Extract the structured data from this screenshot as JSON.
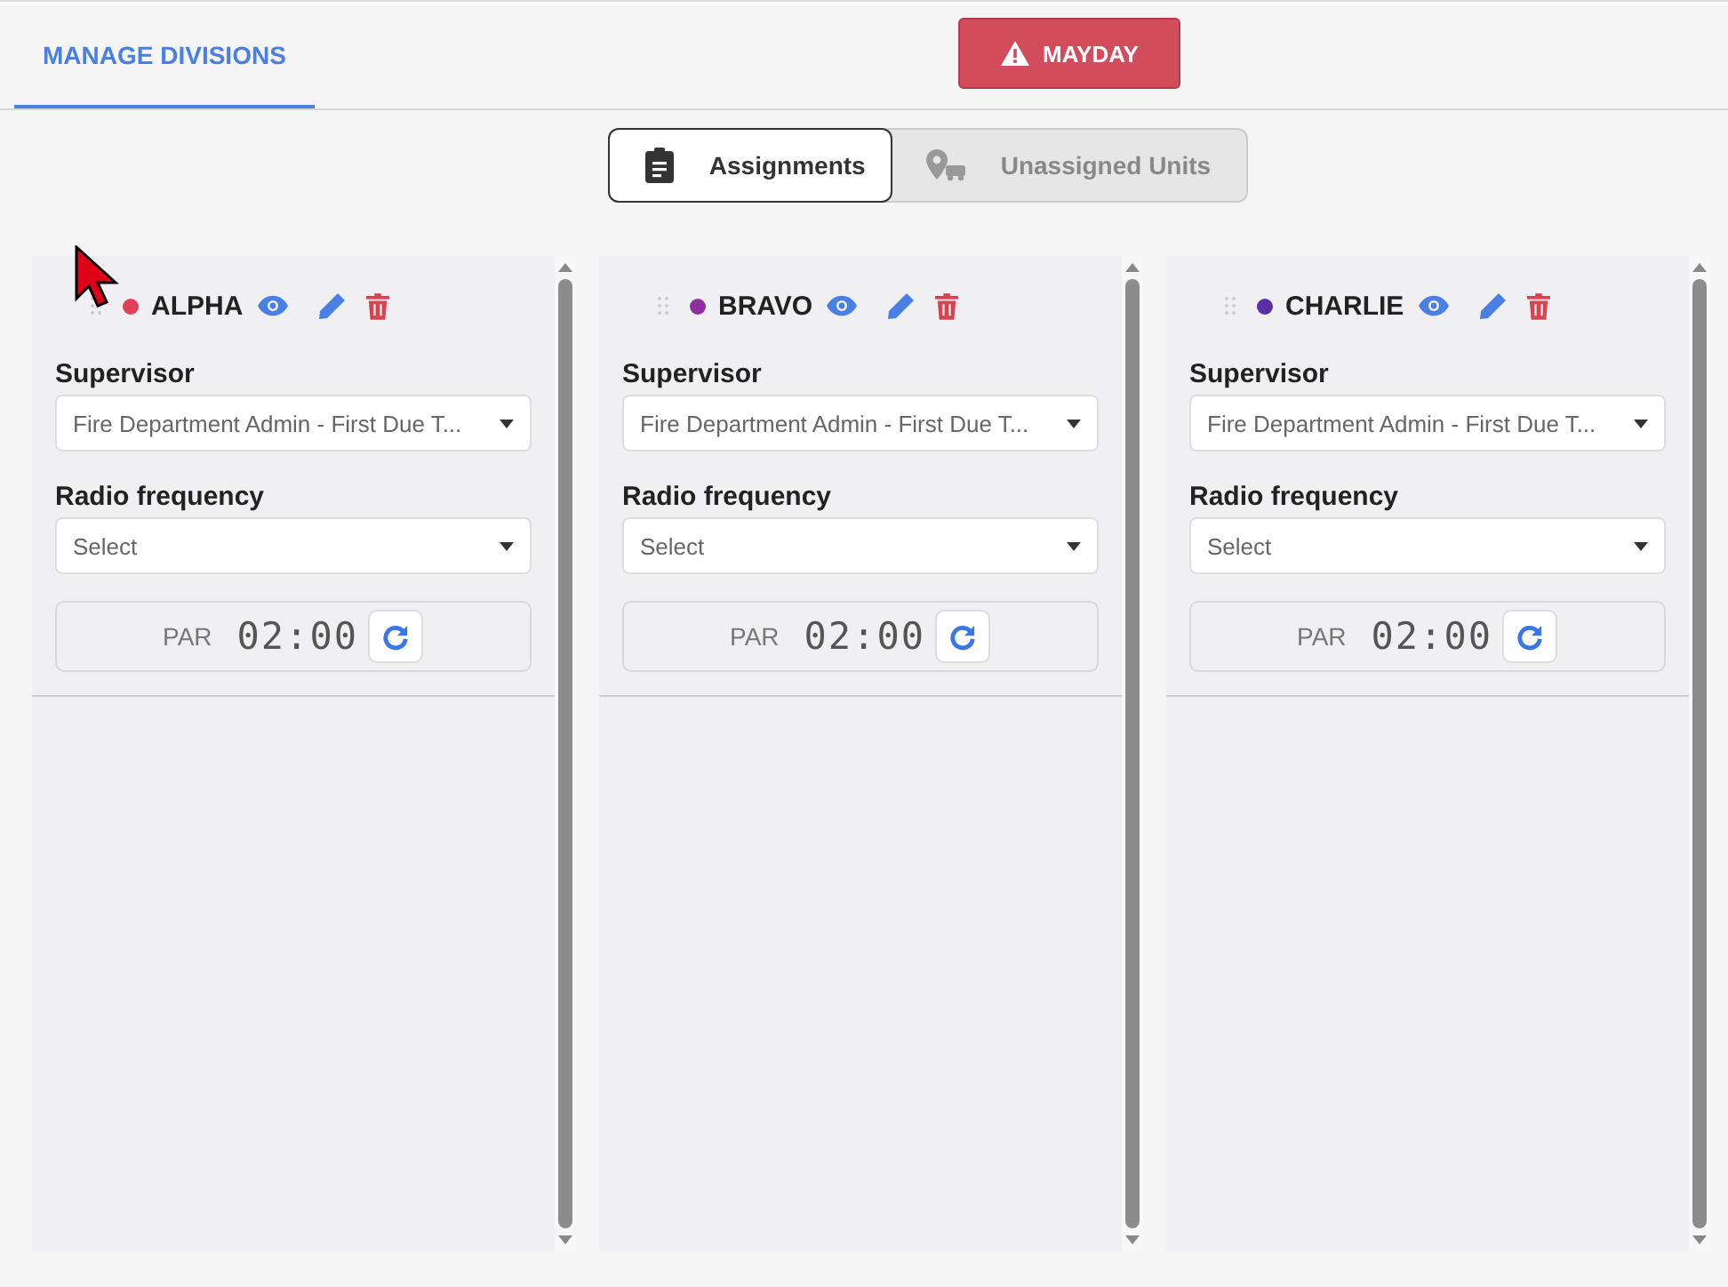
{
  "tabs": [
    {
      "label": "MANAGE DIVISIONS",
      "selected": true
    }
  ],
  "mayday_button": {
    "label": "MAYDAY"
  },
  "view_toggle": [
    {
      "label": "Assignments",
      "selected": true
    },
    {
      "label": "Unassigned Units",
      "selected": false
    }
  ],
  "divisions": [
    {
      "name": "ALPHA",
      "color": "#e0405a",
      "supervisor_label": "Supervisor",
      "supervisor_value": "Fire Department Admin - First Due T...",
      "radio_label": "Radio frequency",
      "radio_placeholder": "Select",
      "par_label": "PAR",
      "par_timer": "02:00"
    },
    {
      "name": "BRAVO",
      "color": "#8e2fa0",
      "supervisor_label": "Supervisor",
      "supervisor_value": "Fire Department Admin - First Due T...",
      "radio_label": "Radio frequency",
      "radio_placeholder": "Select",
      "par_label": "PAR",
      "par_timer": "02:00"
    },
    {
      "name": "CHARLIE",
      "color": "#5a2fa8",
      "supervisor_label": "Supervisor",
      "supervisor_value": "Fire Department Admin - First Due T...",
      "radio_label": "Radio frequency",
      "radio_placeholder": "Select",
      "par_label": "PAR",
      "par_timer": "02:00"
    }
  ]
}
